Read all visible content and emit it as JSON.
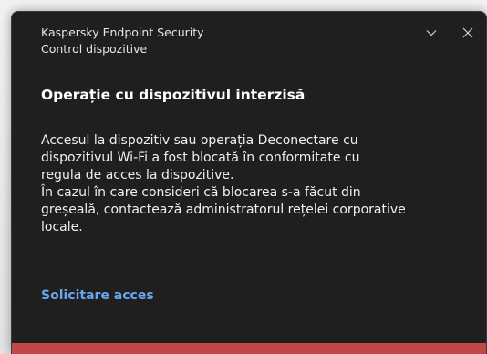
{
  "notification": {
    "app_name": "Kaspersky Endpoint Security",
    "component": "Control dispozitive",
    "title": "Operație cu dispozitivul interzisă",
    "message_lines": [
      "Accesul la dispozitiv sau operația Deconectare cu",
      "dispozitivul Wi-Fi a fost blocată în conformitate cu",
      "regula de acces la dispozitive.",
      "În cazul în care consideri că blocarea s-a făcut din",
      "greșeală, contactează administratorul rețelei corporative",
      "locale."
    ],
    "action_label": "Solicitare acces"
  },
  "icons": {
    "collapse": "chevron-down-icon",
    "close": "close-icon"
  },
  "colors": {
    "background": "#1f1f1f",
    "link": "#6aa6ef",
    "accent": "#c24848"
  }
}
